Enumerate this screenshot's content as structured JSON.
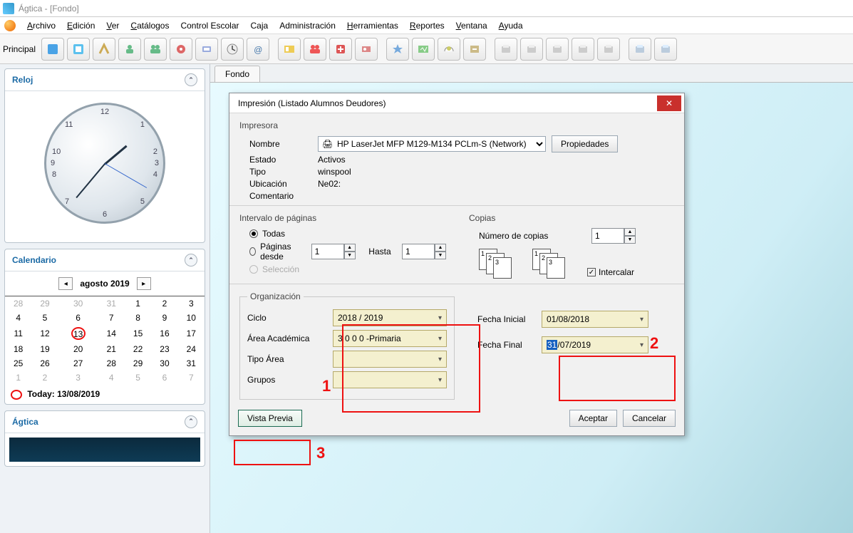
{
  "app": {
    "title": "Ágtica - [Fondo]"
  },
  "menubar": {
    "items": [
      {
        "label": "Archivo",
        "underline": 0
      },
      {
        "label": "Edición",
        "underline": 0
      },
      {
        "label": "Ver",
        "underline": 0
      },
      {
        "label": "Catálogos",
        "underline": 0
      },
      {
        "label": "Control Escolar",
        "underline": -1
      },
      {
        "label": "Caja",
        "underline": -1
      },
      {
        "label": "Administración",
        "underline": -1
      },
      {
        "label": "Herramientas",
        "underline": 0
      },
      {
        "label": "Reportes",
        "underline": 0
      },
      {
        "label": "Ventana",
        "underline": 0
      },
      {
        "label": "Ayuda",
        "underline": 0
      }
    ]
  },
  "toolbar": {
    "section_label": "Principal"
  },
  "sidebar": {
    "reloj": {
      "title": "Reloj"
    },
    "calendario": {
      "title": "Calendario",
      "month_label": "agosto 2019",
      "dow": [
        "",
        "",
        "",
        "",
        "",
        "",
        ""
      ],
      "weeks": [
        [
          {
            "d": "28",
            "other": true
          },
          {
            "d": "29",
            "other": true
          },
          {
            "d": "30",
            "other": true
          },
          {
            "d": "31",
            "other": true
          },
          {
            "d": "1"
          },
          {
            "d": "2"
          },
          {
            "d": "3"
          }
        ],
        [
          {
            "d": "4"
          },
          {
            "d": "5"
          },
          {
            "d": "6"
          },
          {
            "d": "7"
          },
          {
            "d": "8"
          },
          {
            "d": "9"
          },
          {
            "d": "10"
          }
        ],
        [
          {
            "d": "11"
          },
          {
            "d": "12"
          },
          {
            "d": "13",
            "sel": true
          },
          {
            "d": "14"
          },
          {
            "d": "15"
          },
          {
            "d": "16"
          },
          {
            "d": "17"
          }
        ],
        [
          {
            "d": "18"
          },
          {
            "d": "19"
          },
          {
            "d": "20"
          },
          {
            "d": "21"
          },
          {
            "d": "22"
          },
          {
            "d": "23"
          },
          {
            "d": "24"
          }
        ],
        [
          {
            "d": "25"
          },
          {
            "d": "26"
          },
          {
            "d": "27"
          },
          {
            "d": "28"
          },
          {
            "d": "29"
          },
          {
            "d": "30"
          },
          {
            "d": "31"
          }
        ],
        [
          {
            "d": "1",
            "other": true
          },
          {
            "d": "2",
            "other": true
          },
          {
            "d": "3",
            "other": true
          },
          {
            "d": "4",
            "other": true
          },
          {
            "d": "5",
            "other": true
          },
          {
            "d": "6",
            "other": true
          },
          {
            "d": "7",
            "other": true
          }
        ]
      ],
      "today_label": "Today: 13/08/2019"
    },
    "agtica": {
      "title": "Ágtica"
    }
  },
  "content": {
    "tab_label": "Fondo"
  },
  "dialog": {
    "title": "Impresión (Listado Alumnos Deudores)",
    "printer": {
      "section": "Impresora",
      "name_label": "Nombre",
      "name_value": "HP LaserJet MFP M129-M134 PCLm-S (Network)",
      "props_button": "Propiedades",
      "estado_label": "Estado",
      "estado_value": "Activos",
      "tipo_label": "Tipo",
      "tipo_value": "winspool",
      "ubicacion_label": "Ubicación",
      "ubicacion_value": "Ne02:",
      "comentario_label": "Comentario",
      "comentario_value": ""
    },
    "range": {
      "section": "Intervalo de páginas",
      "all_label": "Todas",
      "from_label": "Páginas desde",
      "from_value": "1",
      "to_label": "Hasta",
      "to_value": "1",
      "selection_label": "Selección"
    },
    "copies": {
      "section": "Copias",
      "count_label": "Número de copias",
      "count_value": "1",
      "collate_label": "Intercalar"
    },
    "org": {
      "section": "Organización",
      "ciclo_label": "Ciclo",
      "ciclo_value": "2018 / 2019",
      "area_label": "Área Académica",
      "area_value": "3 0 0 0 -Primaria",
      "tipo_area_label": "Tipo Área",
      "tipo_area_value": "",
      "grupos_label": "Grupos",
      "grupos_value": "",
      "fecha_ini_label": "Fecha Inicial",
      "fecha_ini_value": "01/08/2018",
      "fecha_fin_label": "Fecha Final",
      "fecha_fin_prefix": "31",
      "fecha_fin_rest": "/07/2019"
    },
    "buttons": {
      "preview": "Vista Previa",
      "ok": "Aceptar",
      "cancel": "Cancelar"
    }
  },
  "annotations": {
    "a1": "1",
    "a2": "2",
    "a3": "3"
  }
}
